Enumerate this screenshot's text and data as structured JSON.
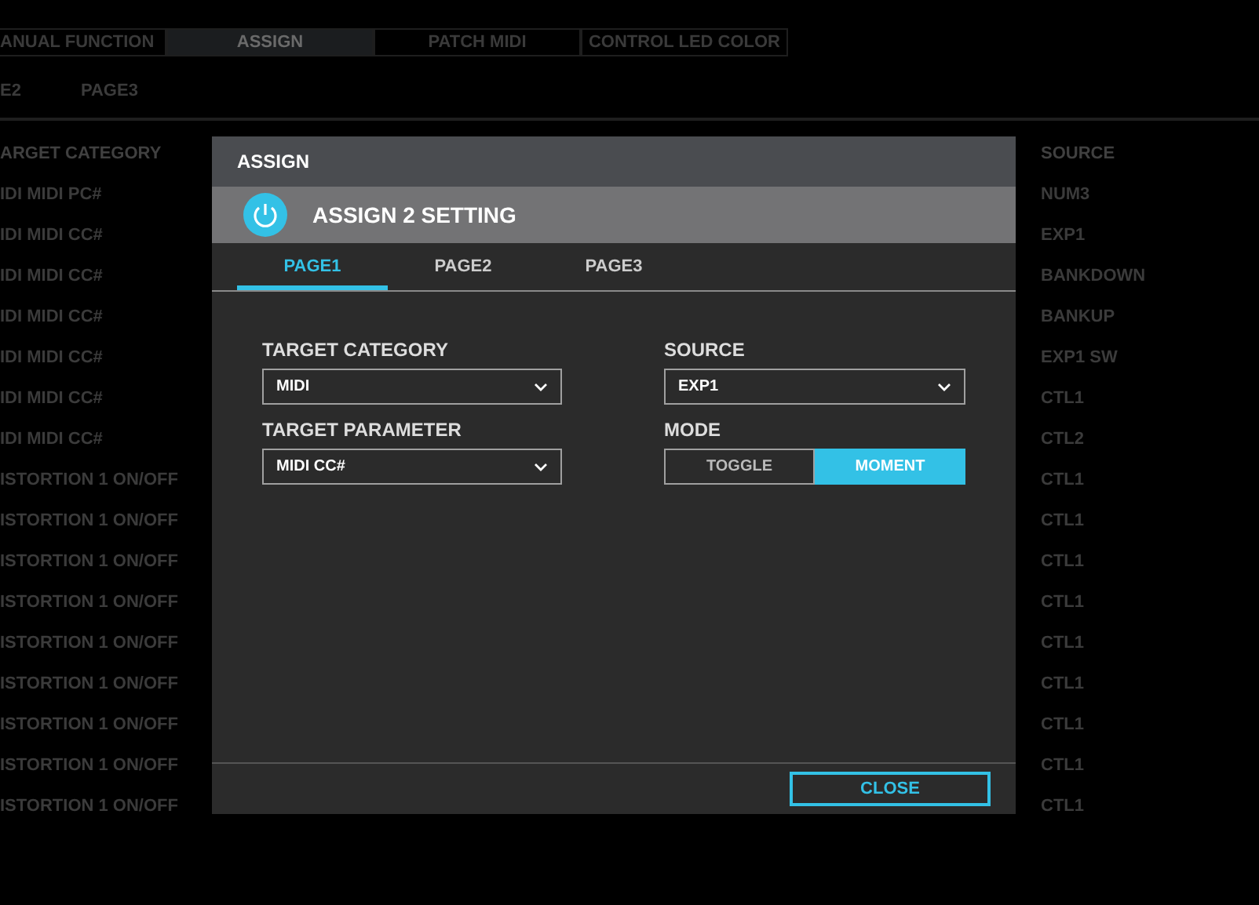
{
  "top_tabs": [
    {
      "label": "ANUAL FUNCTION",
      "selected": false
    },
    {
      "label": "ASSIGN",
      "selected": true
    },
    {
      "label": "PATCH MIDI",
      "selected": false
    },
    {
      "label": "CONTROL LED COLOR",
      "selected": false
    }
  ],
  "sub_tabs": [
    {
      "label": "E2"
    },
    {
      "label": "PAGE3"
    }
  ],
  "list": {
    "columns": [
      "ARGET CATEGORY",
      "SOURCE"
    ],
    "rows": [
      [
        "IDI MIDI PC#",
        "NUM3"
      ],
      [
        "IDI MIDI CC#",
        "EXP1"
      ],
      [
        "IDI MIDI CC#",
        "BANKDOWN"
      ],
      [
        "IDI MIDI CC#",
        "BANKUP"
      ],
      [
        "IDI MIDI CC#",
        "EXP1 SW"
      ],
      [
        "IDI MIDI CC#",
        "CTL1"
      ],
      [
        "IDI MIDI CC#",
        "CTL2"
      ],
      [
        "ISTORTION 1 ON/OFF",
        "CTL1"
      ],
      [
        "ISTORTION 1 ON/OFF",
        "CTL1"
      ],
      [
        "ISTORTION 1 ON/OFF",
        "CTL1"
      ],
      [
        "ISTORTION 1 ON/OFF",
        "CTL1"
      ],
      [
        "ISTORTION 1 ON/OFF",
        "CTL1"
      ],
      [
        "ISTORTION 1 ON/OFF",
        "CTL1"
      ],
      [
        "ISTORTION 1 ON/OFF",
        "CTL1"
      ],
      [
        "ISTORTION 1 ON/OFF",
        "CTL1"
      ],
      [
        "ISTORTION 1 ON/OFF",
        "CTL1"
      ]
    ]
  },
  "dialog": {
    "title": "ASSIGN",
    "heading": "ASSIGN 2 SETTING",
    "tabs": [
      {
        "label": "PAGE1",
        "selected": true
      },
      {
        "label": "PAGE2",
        "selected": false
      },
      {
        "label": "PAGE3",
        "selected": false
      }
    ],
    "fields": [
      {
        "kind": "dropdown",
        "label": "TARGET CATEGORY",
        "value": "MIDI"
      },
      {
        "kind": "dropdown",
        "label": "SOURCE",
        "value": "EXP1"
      },
      {
        "kind": "dropdown",
        "label": "TARGET PARAMETER",
        "value": "MIDI CC#"
      },
      {
        "kind": "segmented",
        "label": "MODE",
        "options": [
          {
            "label": "TOGGLE",
            "selected": false
          },
          {
            "label": "MOMENT",
            "selected": true
          }
        ]
      }
    ],
    "close_button": "CLOSE"
  }
}
